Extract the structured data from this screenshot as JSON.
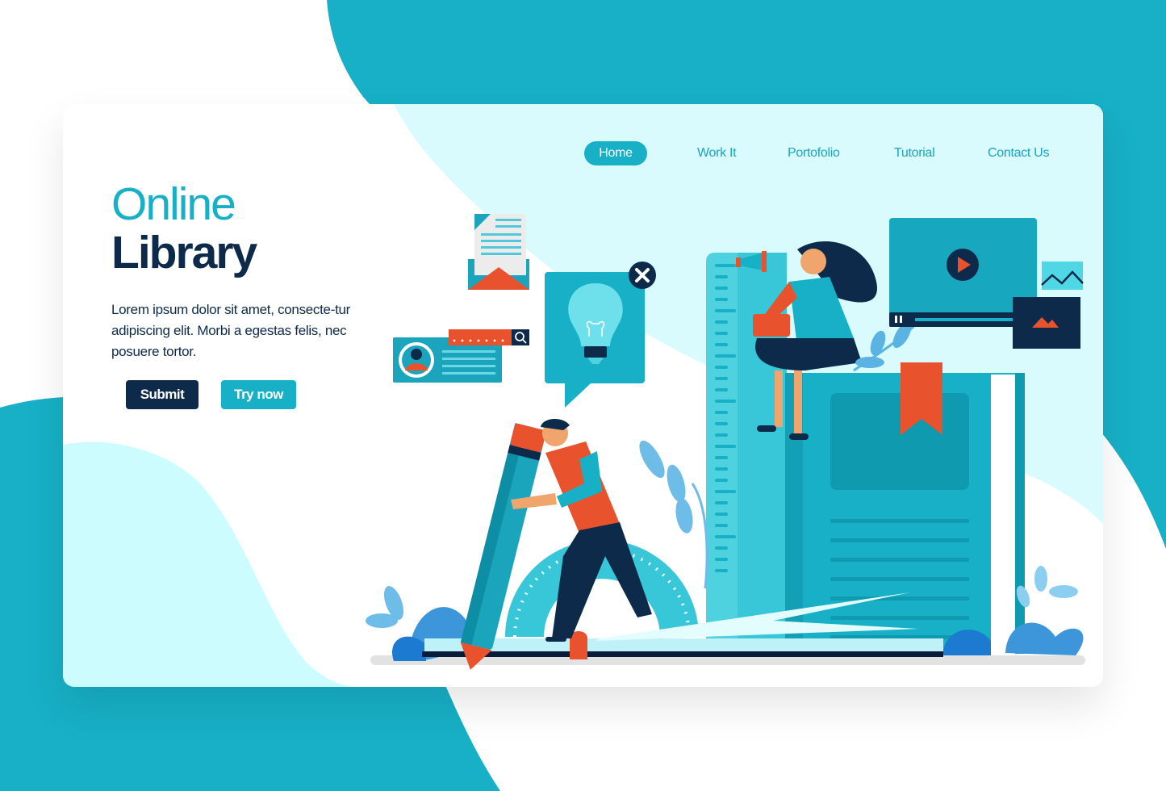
{
  "colors": {
    "primary": "#17b0c6",
    "dark": "#0e2a4a",
    "light_bg": "#d9fbfd",
    "accent": "#e8522d",
    "white": "#ffffff"
  },
  "nav": {
    "items": [
      {
        "label": "Home",
        "active": true
      },
      {
        "label": "Work It",
        "active": false
      },
      {
        "label": "Portofolio",
        "active": false
      },
      {
        "label": "Tutorial",
        "active": false
      },
      {
        "label": "Contact Us",
        "active": false
      }
    ]
  },
  "hero": {
    "title_line1": "Online",
    "title_line2": "Library",
    "description": "Lorem ipsum dolor sit amet, consecte-tur adipiscing elit. Morbi a egestas felis, nec posuere tortor.",
    "buttons": {
      "submit": "Submit",
      "try_now": "Try now"
    }
  },
  "illustration": {
    "icons": [
      "envelope-icon",
      "lightbulb-icon",
      "close-icon",
      "profile-card-icon",
      "search-icon",
      "video-player-icon",
      "play-icon",
      "pause-icon",
      "image-icon",
      "chart-line-icon",
      "megaphone-icon",
      "bookmark-icon",
      "pencil-icon",
      "protractor-icon",
      "ruler-icon",
      "book-icon"
    ]
  }
}
